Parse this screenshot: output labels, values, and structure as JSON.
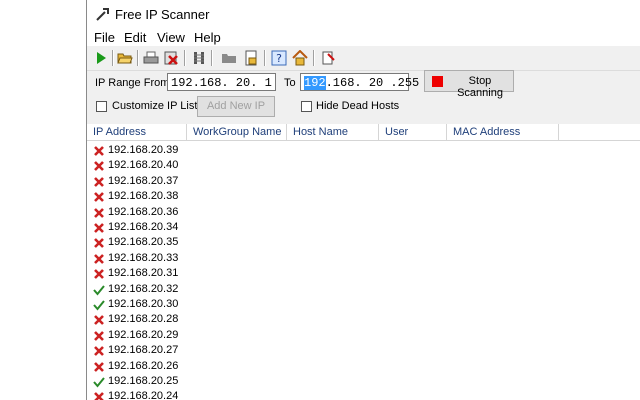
{
  "window": {
    "title": "Free IP Scanner"
  },
  "menu": [
    "File",
    "Edit",
    "View",
    "Help"
  ],
  "toolbar": {
    "icons": [
      "play-icon",
      "open-folder-icon",
      "print-icon",
      "clear-icon",
      "resolve-icon",
      "folder-icon",
      "export-icon",
      "help-icon",
      "home-icon",
      "options-icon"
    ]
  },
  "range": {
    "from_label": "IP Range From",
    "from_value": "192.168. 20. 1",
    "to_label": "To",
    "to_selected": "192",
    "to_rest": ".168. 20 .255",
    "stop_label": "Stop Scanning",
    "stop_color": "#ee0000"
  },
  "options": {
    "customize_label": "Customize IP List",
    "customize_checked": false,
    "add_ip_label": "Add New IP",
    "hide_dead_label": "Hide Dead Hosts",
    "hide_dead_checked": false
  },
  "columns": [
    "IP Address",
    "WorkGroup Name",
    "Host Name",
    "User",
    "MAC Address"
  ],
  "colors": {
    "dead": "#cc2222",
    "alive": "#2a8a2a",
    "header_text": "#1f3f7a"
  },
  "rows": [
    {
      "ip": "192.168.20.39",
      "status": "dead"
    },
    {
      "ip": "192.168.20.40",
      "status": "dead"
    },
    {
      "ip": "192.168.20.37",
      "status": "dead"
    },
    {
      "ip": "192.168.20.38",
      "status": "dead"
    },
    {
      "ip": "192.168.20.36",
      "status": "dead"
    },
    {
      "ip": "192.168.20.34",
      "status": "dead"
    },
    {
      "ip": "192.168.20.35",
      "status": "dead"
    },
    {
      "ip": "192.168.20.33",
      "status": "dead"
    },
    {
      "ip": "192.168.20.31",
      "status": "dead"
    },
    {
      "ip": "192.168.20.32",
      "status": "alive"
    },
    {
      "ip": "192.168.20.30",
      "status": "alive"
    },
    {
      "ip": "192.168.20.28",
      "status": "dead"
    },
    {
      "ip": "192.168.20.29",
      "status": "dead"
    },
    {
      "ip": "192.168.20.27",
      "status": "dead"
    },
    {
      "ip": "192.168.20.26",
      "status": "dead"
    },
    {
      "ip": "192.168.20.25",
      "status": "alive"
    },
    {
      "ip": "192.168.20.24",
      "status": "dead"
    }
  ]
}
